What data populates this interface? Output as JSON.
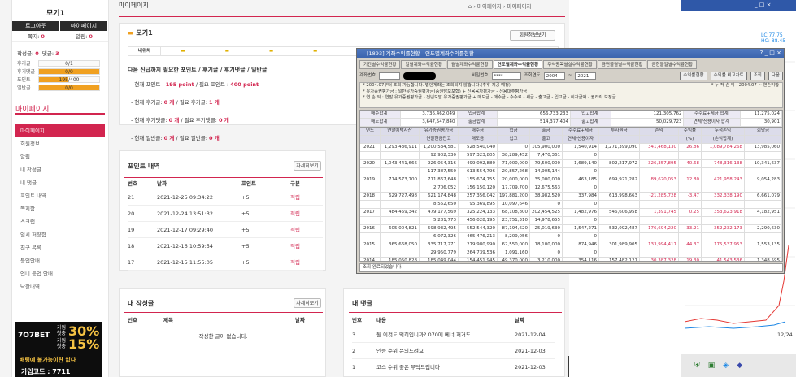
{
  "sidebar": {
    "user": "모기1",
    "logout": "로그아웃",
    "mypage_btn": "마이페이지",
    "stats1": [
      {
        "label": "쪽지",
        "value": "0"
      },
      {
        "label": "알림",
        "value": "0"
      }
    ],
    "posts_label": "작성글",
    "posts": "0",
    "comments_label": "댓글",
    "comments": "3",
    "bars": [
      {
        "label": "후기글",
        "text": "0/1",
        "fraction": 0
      },
      {
        "label": "후기댓글",
        "text": "0/0",
        "fraction": 1
      },
      {
        "label": "포인트",
        "text": "195/400",
        "fraction": 0.49
      },
      {
        "label": "일반글",
        "text": "0/0",
        "fraction": 1
      }
    ],
    "menu_title": "마이페이지",
    "menu": [
      "마이페이지",
      "회원정보",
      "알림",
      "내 작성글",
      "내 댓글",
      "포인트 내역",
      "쪽지함",
      "스크랩",
      "임시 저장함",
      "친구 목록",
      "등업안내",
      "언니 등업 안내",
      "낙찰내역"
    ],
    "banner": {
      "t1": "가입",
      "t2": "첫충",
      "pct1": "30%",
      "t3": "가입",
      "t4": "첫충",
      "pct2": "15%",
      "brand": "7O7BET",
      "slogan": "배팅에 불가능이란 없다",
      "code": "가입코드 : 7711"
    }
  },
  "main": {
    "title": "마이페이지",
    "breadcrumb": [
      "마이페이지",
      "마이페이지"
    ],
    "user": "모기1",
    "profile_btn": "회원정보보기",
    "tab_label": "내위치",
    "grade_heading": "다음 진급까지 필요한 포인트 / 후기글 / 후기댓글 / 일반글",
    "grade_lines": [
      {
        "pre": "- 현재 포인트 : ",
        "v1": "195 point",
        "mid": " / 필요 포인트 : ",
        "v2": "400 point"
      },
      {
        "pre": "- 현재 후기글: ",
        "v1": "0 개",
        "mid": " / 필요 후기글: ",
        "v2": "1 개"
      },
      {
        "pre": "- 현재 후기댓글: ",
        "v1": "0 개",
        "mid": " / 필요 후기댓글: ",
        "v2": "0 개"
      },
      {
        "pre": "- 현재 일반글: ",
        "v1": "0 개",
        "mid": " / 필요 일반글: ",
        "v2": "0 개"
      }
    ],
    "points": {
      "title": "포인트 내역",
      "more": "자세히보기",
      "headers": [
        "번호",
        "날짜",
        "포인트",
        "구분"
      ],
      "rows": [
        [
          "21",
          "2021-12-25 09:34:22",
          "+5",
          "적립"
        ],
        [
          "20",
          "2021-12-24 13:51:32",
          "+5",
          "적립"
        ],
        [
          "19",
          "2021-12-17 09:29:40",
          "+5",
          "적립"
        ],
        [
          "18",
          "2021-12-16 10:59:54",
          "+5",
          "적립"
        ],
        [
          "17",
          "2021-12-15 11:55:05",
          "+5",
          "적립"
        ]
      ]
    },
    "myposts": {
      "title": "내 작성글",
      "more": "자세히보기",
      "headers": [
        "번호",
        "제목",
        "날짜"
      ],
      "empty": "작성한 글이 없습니다."
    },
    "mycomments": {
      "title": "내 댓글",
      "more": "자세히보기",
      "headers": [
        "번호",
        "내용",
        "날짜"
      ],
      "rows": [
        [
          "3",
          "될 이것도 먹히입니까? 070에 베너 저거도...",
          "2021-12-04"
        ],
        [
          "2",
          "인증 수위 문의드려요",
          "2021-12-03"
        ],
        [
          "1",
          "코스 수위 좋은 부탁드립니다",
          "2021-12-03"
        ]
      ]
    }
  },
  "dialog": {
    "title": "[1893] 계좌수익률현황 - 연도별계좌수익률현황",
    "tabs": [
      "기간별수익률현황",
      "일별계좌수익률현황",
      "월별계좌수익률현황",
      "연도별계좌수익률현황",
      "주식종목별실수익률현황",
      "금현물월별수익률현황",
      "금현물일별수익률현황"
    ],
    "active_tab": 3,
    "acct_label": "계좌번호",
    "pw_label": "비밀번호",
    "pw": "****",
    "year_label": "조회연도",
    "from": "2004",
    "to": "2021",
    "btn1": "수익률현황",
    "btn2": "수익률 비교차트",
    "btn3": "조회",
    "btn4": "다음",
    "notes": [
      "* 2004.07부터 조회 가능합니다. 법인계좌는 조회되지 않습니다.(추후 제공 예정)",
      "* 유가증권평가금 : 일반유가증권평가금(증권담보포함) + 신용융자평가금 - 신용대주평가금",
      "* 연 손 익 : 연말 유가증권평가금 - 전년도말 유가증권평가금 + 매도금 - 매수금 - 수수료 - 세금 - 출고금 - 입고금 - 이자금액 - 권리락 보정금"
    ],
    "note_right": "* 누 적 손 익 : 2004.07 ~ 연손익합",
    "summary": [
      [
        "매수합계",
        "3,736,462,049",
        "입금합계",
        "656,733,233",
        "입고합계",
        "121,305,762",
        "수수료+세금 합계",
        "11,275,024"
      ],
      [
        "매도합계",
        "3,647,547,840",
        "출금합계",
        "514,377,404",
        "출고합계",
        "50,029,723",
        "연체/신용이자 합계",
        "30,901"
      ]
    ],
    "head1": [
      "연도",
      "연말예탁자산",
      "유가증권평가금",
      "매수금",
      "입금",
      "출금",
      "수수료+세금",
      "투자원금",
      "손익",
      "수익률",
      "누적손익",
      "회당금"
    ],
    "head2": [
      "",
      "",
      "연말현금잔고",
      "매도금",
      "입고",
      "출고",
      "연체/신용이자",
      "",
      "",
      "(%)",
      "(손익합계)",
      ""
    ],
    "rows": [
      [
        "2021",
        "1,293,436,911",
        "1,200,534,581",
        "528,540,040",
        "0",
        "105,900,000",
        "1,540,914",
        "1,271,399,090",
        "341,468,130",
        "26.86",
        "1,089,784,268",
        "13,985,060"
      ],
      [
        "",
        "",
        "92,902,330",
        "597,323,805",
        "38,289,452",
        "7,470,361",
        "0",
        "",
        "",
        "",
        "",
        ""
      ],
      [
        "2020",
        "1,043,441,666",
        "926,054,316",
        "499,092,880",
        "71,000,000",
        "79,500,000",
        "1,689,140",
        "802,217,972",
        "326,357,895",
        "40.68",
        "748,316,138",
        "10,341,637"
      ],
      [
        "",
        "",
        "117,387,550",
        "613,554,796",
        "20,857,268",
        "14,905,144",
        "0",
        "",
        "",
        "",
        "",
        ""
      ],
      [
        "2019",
        "714,573,700",
        "711,867,648",
        "155,674,755",
        "20,000,000",
        "35,000,000",
        "463,185",
        "699,921,282",
        "89,620,053",
        "12.80",
        "421,958,243",
        "9,054,283"
      ],
      [
        "",
        "",
        "2,706,052",
        "156,150,120",
        "17,709,700",
        "12,675,563",
        "0",
        "",
        "",
        "",
        "",
        ""
      ],
      [
        "2018",
        "629,727,498",
        "621,174,848",
        "257,356,042",
        "197,881,200",
        "38,982,520",
        "337,984",
        "613,998,663",
        "-21,285,728",
        "-3.47",
        "332,338,190",
        "6,661,079"
      ],
      [
        "",
        "",
        "8,552,650",
        "95,369,895",
        "10,097,646",
        "0",
        "0",
        "",
        "",
        "",
        "",
        ""
      ],
      [
        "2017",
        "484,459,342",
        "479,177,569",
        "325,224,133",
        "68,108,800",
        "202,454,525",
        "1,482,976",
        "546,606,958",
        "1,391,745",
        "0.25",
        "353,623,918",
        "4,182,951"
      ],
      [
        "",
        "",
        "5,281,773",
        "456,028,195",
        "23,751,310",
        "14,978,655",
        "0",
        "",
        "",
        "",
        "",
        ""
      ],
      [
        "2016",
        "605,004,821",
        "598,932,495",
        "552,544,320",
        "87,194,620",
        "25,019,630",
        "1,547,271",
        "532,092,487",
        "176,694,220",
        "33.21",
        "352,232,173",
        "2,290,630"
      ],
      [
        "",
        "",
        "6,072,326",
        "465,476,213",
        "8,209,056",
        "0",
        "0",
        "",
        "",
        "",
        "",
        ""
      ],
      [
        "2015",
        "365,668,050",
        "335,717,271",
        "279,980,990",
        "62,550,000",
        "18,100,000",
        "874,946",
        "301,989,905",
        "133,994,417",
        "44.37",
        "175,537,953",
        "1,553,135"
      ],
      [
        "",
        "",
        "29,950,779",
        "264,739,536",
        "1,091,160",
        "0",
        "0",
        "",
        "",
        "",
        "",
        ""
      ],
      [
        "2014",
        "185,050,828",
        "185,049,044",
        "154,451,945",
        "49,370,000",
        "3,210,000",
        "354,116",
        "157,482,121",
        "30,387,328",
        "19.30",
        "41,543,536",
        "1,348,595"
      ]
    ],
    "status": "조회 완료되었습니다."
  },
  "right_panel": {
    "label1": "LC:77.75",
    "label2": "HC:-88.45",
    "date": "12/24"
  }
}
